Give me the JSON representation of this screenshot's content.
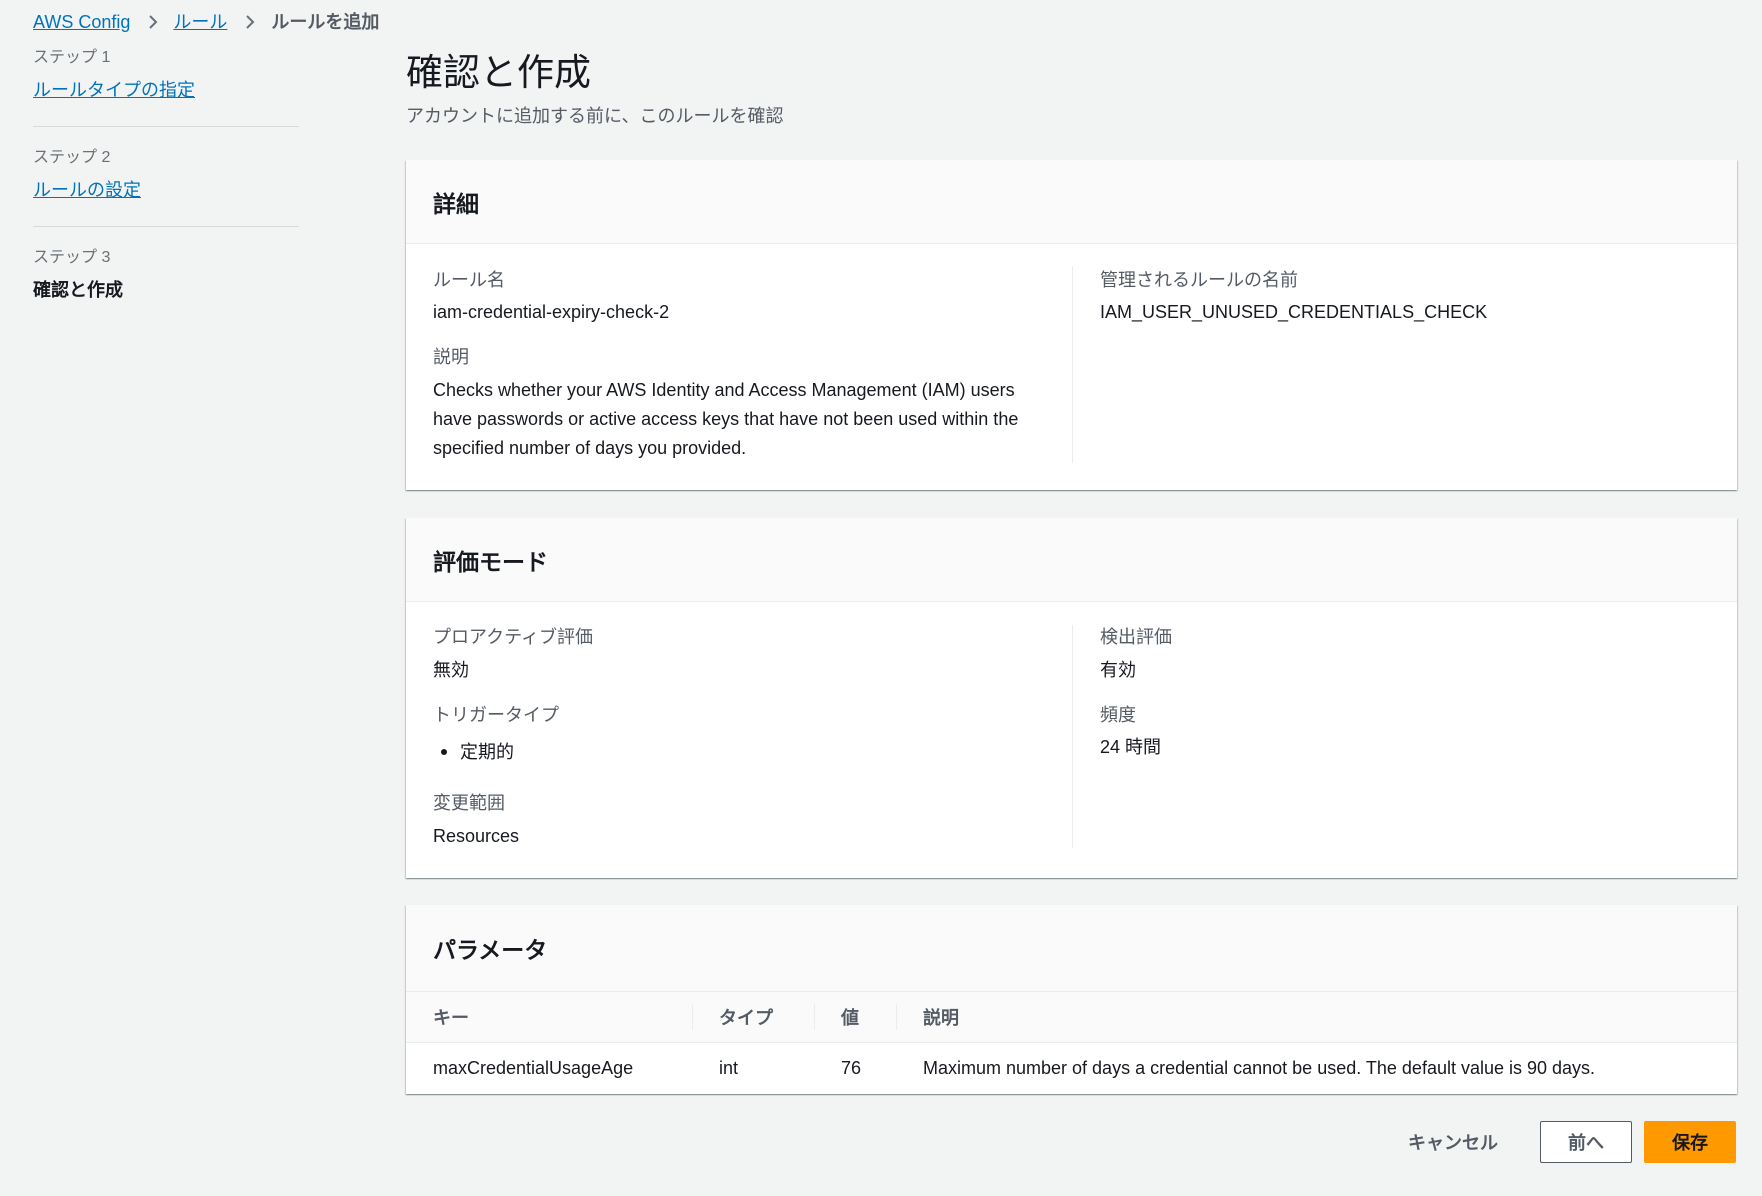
{
  "breadcrumb": {
    "items": [
      {
        "label": "AWS Config"
      },
      {
        "label": "ルール"
      }
    ],
    "current": "ルールを追加"
  },
  "steps": [
    {
      "label": "ステップ 1",
      "title": "ルールタイプの指定"
    },
    {
      "label": "ステップ 2",
      "title": "ルールの設定"
    },
    {
      "label": "ステップ 3",
      "title": "確認と作成"
    }
  ],
  "page": {
    "title": "確認と作成",
    "subtitle": "アカウントに追加する前に、このルールを確認"
  },
  "details": {
    "heading": "詳細",
    "rule_name": {
      "label": "ルール名",
      "value": "iam-credential-expiry-check-2"
    },
    "description": {
      "label": "説明",
      "value": "Checks whether your AWS Identity and Access Management (IAM) users have passwords or active access keys that have not been used within the specified number of days you provided."
    },
    "managed_rule_name": {
      "label": "管理されるルールの名前",
      "value": "IAM_USER_UNUSED_CREDENTIALS_CHECK"
    }
  },
  "evaluation_mode": {
    "heading": "評価モード",
    "proactive": {
      "label": "プロアクティブ評価",
      "value": "無効"
    },
    "trigger_type": {
      "label": "トリガータイプ",
      "values": [
        "定期的"
      ]
    },
    "scope_of_changes": {
      "label": "変更範囲",
      "value": "Resources"
    },
    "detective": {
      "label": "検出評価",
      "value": "有効"
    },
    "frequency": {
      "label": "頻度",
      "value": "24 時間"
    }
  },
  "parameters": {
    "heading": "パラメータ",
    "columns": [
      "キー",
      "タイプ",
      "値",
      "説明"
    ],
    "rows": [
      {
        "key": "maxCredentialUsageAge",
        "type": "int",
        "value": "76",
        "description": "Maximum number of days a credential cannot be used. The default value is 90 days."
      }
    ]
  },
  "actions": {
    "cancel": "キャンセル",
    "previous": "前へ",
    "save": "保存"
  },
  "icons": {
    "breadcrumb_separator": "chevron-right-icon",
    "list_bullet": "bullet-icon"
  },
  "colors": {
    "link": "#0073bb",
    "primary": "#ff9900",
    "background": "#f2f3f3",
    "text": "#16191f",
    "label": "#545b64"
  }
}
